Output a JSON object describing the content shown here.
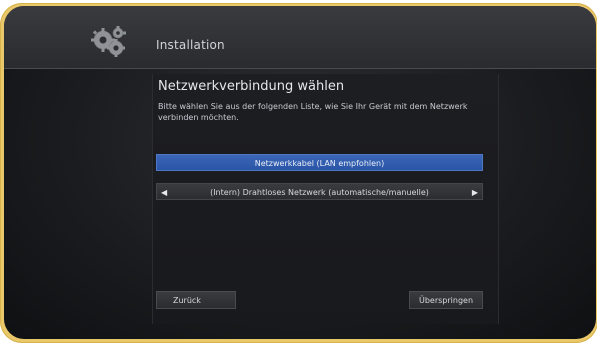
{
  "header": {
    "title": "Installation",
    "logo_icon": "gears-icon"
  },
  "main": {
    "title": "Netzwerkverbindung wählen",
    "description_line1": "Bitte wählen Sie aus der folgenden Liste, wie Sie Ihr Gerät mit dem Netzwerk",
    "description_line2": "verbinden möchten.",
    "options": [
      {
        "label": "Netzwerkkabel (LAN empfohlen)",
        "selected": true
      },
      {
        "label": "(Intern) Drahtloses Netzwerk (automatische/manuelle)",
        "selected": false
      }
    ]
  },
  "footer": {
    "back_label": "Zurück",
    "skip_label": "Überspringen"
  },
  "colors": {
    "frame": "#e9c86a",
    "selected_option": "#3c67b8",
    "screen_bg": "#1b1c1f"
  }
}
